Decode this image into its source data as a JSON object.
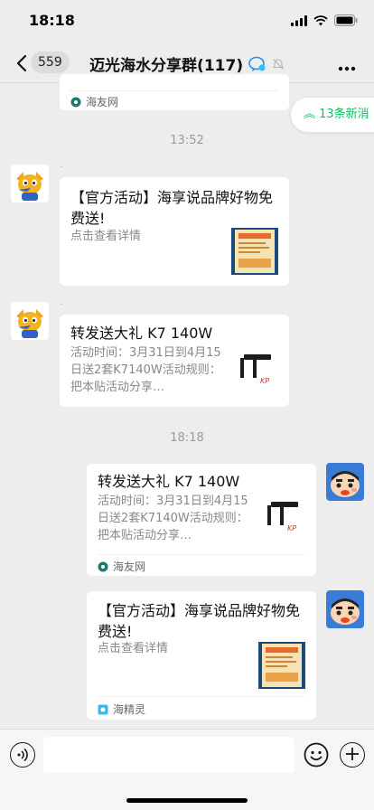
{
  "status_bar": {
    "time": "18:18"
  },
  "nav": {
    "unread_count": "559",
    "title": "迈光海水分享群(117)"
  },
  "new_messages": {
    "label": "13条新消"
  },
  "messages": {
    "top_partial": {
      "source": "海友网"
    },
    "time_1": "13:52",
    "msg1": {
      "title": "【官方活动】海享说品牌好物免费送!",
      "desc": "点击查看详情"
    },
    "msg2": {
      "title": "转发送大礼 K7 140W",
      "desc": "活动时间：3月31日到4月15日送2套K7140W活动规则：把本贴活动分享…"
    },
    "time_2": "18:18",
    "msg3": {
      "title": "转发送大礼 K7 140W",
      "desc": "活动时间：3月31日到4月15日送2套K7140W活动规则：把本贴活动分享…",
      "source": "海友网"
    },
    "msg4": {
      "title": "【官方活动】海享说品牌好物免费送!",
      "desc": "点击查看详情",
      "source": "海精灵"
    }
  },
  "icons": {
    "back": "chevron-left-icon",
    "more": "more-icon",
    "voice": "voice-icon",
    "emoji": "emoji-icon",
    "plus": "plus-icon"
  },
  "colors": {
    "accent": "#07c160",
    "background": "#ededed"
  }
}
